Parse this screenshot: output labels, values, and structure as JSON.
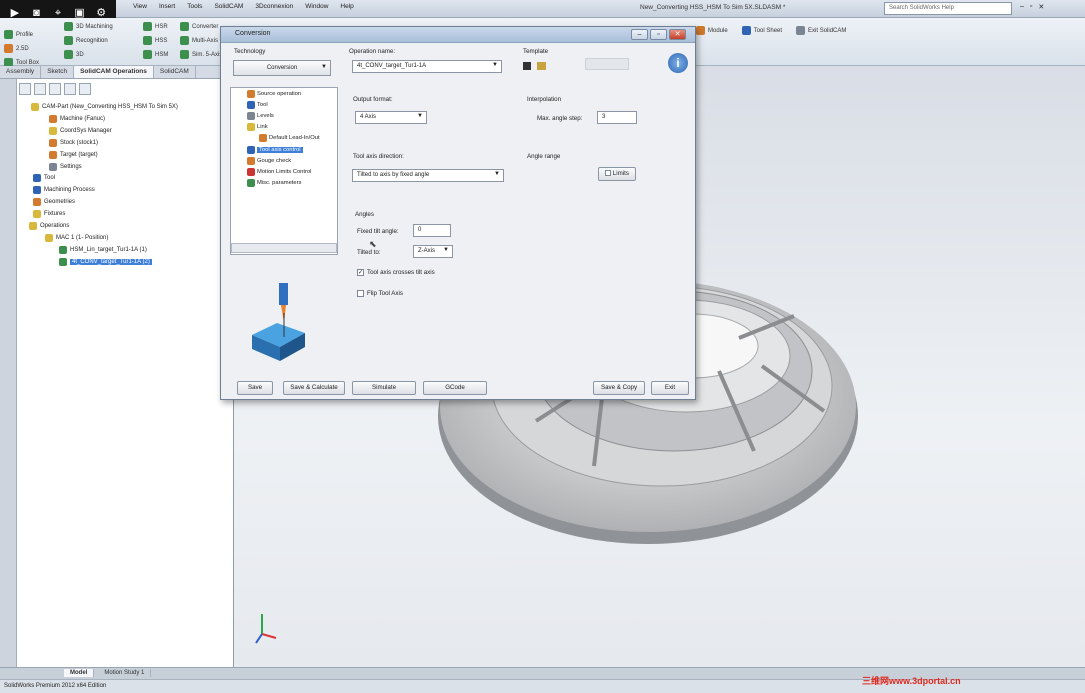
{
  "menu": [
    "View",
    "Insert",
    "Tools",
    "SolidCAM",
    "3Dconnexion",
    "Window",
    "Help"
  ],
  "document_title": "New_Converting HSS_HSM To Sim 5X.SLDASM *",
  "help_search_placeholder": "Search SolidWorks Help",
  "ribbon": {
    "left": [
      {
        "label": "Profile"
      },
      {
        "label": "2.5D"
      },
      {
        "label": "Tool Box"
      }
    ],
    "mid": [
      {
        "label": "3D Machining"
      },
      {
        "label": "Recognition"
      },
      {
        "label": "3D"
      }
    ],
    "right1": [
      {
        "label": "HSR"
      },
      {
        "label": "HSS"
      },
      {
        "label": "HSM"
      }
    ],
    "right2": [
      {
        "label": "Converter"
      },
      {
        "label": "Multi-Axis"
      },
      {
        "label": "Sim. 5-Axis"
      }
    ],
    "far": [
      {
        "label": "Module"
      },
      {
        "label": "Tool Sheet"
      },
      {
        "label": "Exit SolidCAM"
      }
    ]
  },
  "tabs": [
    "Assembly",
    "Sketch",
    "SolidCAM Operations",
    "SolidCAM"
  ],
  "tree": [
    {
      "label": "CAM-Part (New_Converting HSS_HSM To Sim 5X)",
      "level": 0,
      "icon": "part-icon"
    },
    {
      "label": "Machine (Fanuc)",
      "level": 1,
      "icon": "machine-icon"
    },
    {
      "label": "CoordSys Manager",
      "level": 1,
      "icon": "coordsys-icon"
    },
    {
      "label": "Stock (stock1)",
      "level": 1,
      "icon": "stock-icon"
    },
    {
      "label": "Target (target)",
      "level": 1,
      "icon": "target-icon"
    },
    {
      "label": "Settings",
      "level": 1,
      "icon": "settings-icon"
    },
    {
      "label": "Tool",
      "level": 0,
      "icon": "tool-icon"
    },
    {
      "label": "Machining Process",
      "level": 0,
      "icon": "process-icon"
    },
    {
      "label": "Geometries",
      "level": 0,
      "icon": "geometry-icon"
    },
    {
      "label": "Fixtures",
      "level": 0,
      "icon": "fixture-icon"
    },
    {
      "label": "Operations",
      "level": 0,
      "icon": "folder-icon"
    },
    {
      "label": "MAC 1 (1- Position)",
      "level": 1,
      "icon": "mac-icon"
    },
    {
      "label": "HSM_Lin_target_Tur1-1A (1)",
      "level": 2,
      "icon": "op-icon"
    },
    {
      "label": "4t_CONV_target_Tur1-1A (2)",
      "level": 2,
      "icon": "op-icon",
      "selected": true
    }
  ],
  "bottom_tabs": [
    "Model",
    "Motion Study 1"
  ],
  "status": "SolidWorks Premium 2012 x64 Edition",
  "watermark": "三维网www.3dportal.cn",
  "dialog": {
    "title": "Conversion",
    "technology_label": "Technology",
    "technology_value": "Conversion",
    "operation_name_label": "Operation name:",
    "operation_name_value": "4t_CONV_target_Tur1-1A",
    "template_label": "Template",
    "tree_items": [
      {
        "label": "Source operation",
        "indent": 0
      },
      {
        "label": "Tool",
        "indent": 0
      },
      {
        "label": "Levels",
        "indent": 0
      },
      {
        "label": "Link",
        "indent": 0
      },
      {
        "label": "Default Lead-In/Out",
        "indent": 1
      },
      {
        "label": "Tool axis control",
        "indent": 0,
        "selected": true
      },
      {
        "label": "Gouge check",
        "indent": 0
      },
      {
        "label": "Motion Limits Control",
        "indent": 0
      },
      {
        "label": "Misc. parameters",
        "indent": 0
      }
    ],
    "output_format_label": "Output format:",
    "output_format_value": "4 Axis",
    "interpolation_label": "Interpolation",
    "max_angle_step_label": "Max. angle step:",
    "max_angle_step_value": "3",
    "tool_axis_direction_label": "Tool axis direction:",
    "tool_axis_direction_value": "Tilted to axis by fixed angle",
    "angle_range_label": "Angle range",
    "limits_button": "Limits",
    "angles_label": "Angles",
    "fixed_tilt_label": "Fixed tilt angle:",
    "fixed_tilt_value": "0",
    "tilted_to_label": "Tilted to:",
    "tilted_to_value": "Z-Axis",
    "crosses_label": "Tool axis crosses tilt axis",
    "crosses_checked": true,
    "flip_label": "Flip Tool Axis",
    "flip_checked": false,
    "buttons": [
      "Save",
      "Save & Calculate",
      "Simulate",
      "GCode",
      "Save & Copy",
      "Exit"
    ]
  }
}
